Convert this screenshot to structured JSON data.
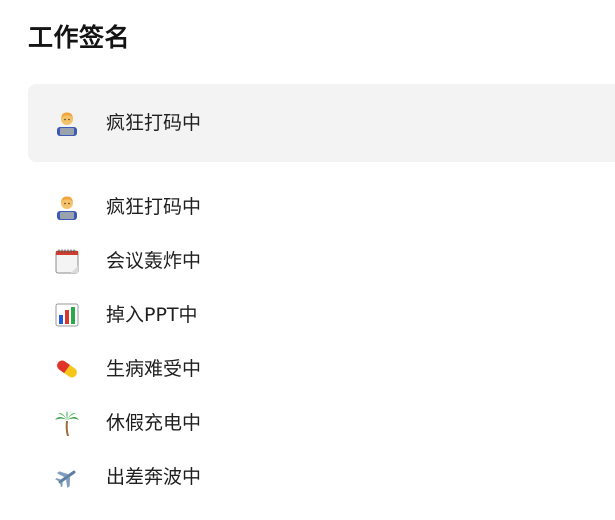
{
  "page": {
    "title": "工作签名"
  },
  "current_status": {
    "icon": "technologist-icon",
    "label": "疯狂打码中"
  },
  "statuses": [
    {
      "icon": "technologist-icon",
      "label": "疯狂打码中"
    },
    {
      "icon": "calendar-icon",
      "label": "会议轰炸中"
    },
    {
      "icon": "bar-chart-icon",
      "label": "掉入PPT中"
    },
    {
      "icon": "pill-icon",
      "label": "生病难受中"
    },
    {
      "icon": "palm-tree-icon",
      "label": "休假充电中"
    },
    {
      "icon": "airplane-icon",
      "label": "出差奔波中"
    }
  ]
}
